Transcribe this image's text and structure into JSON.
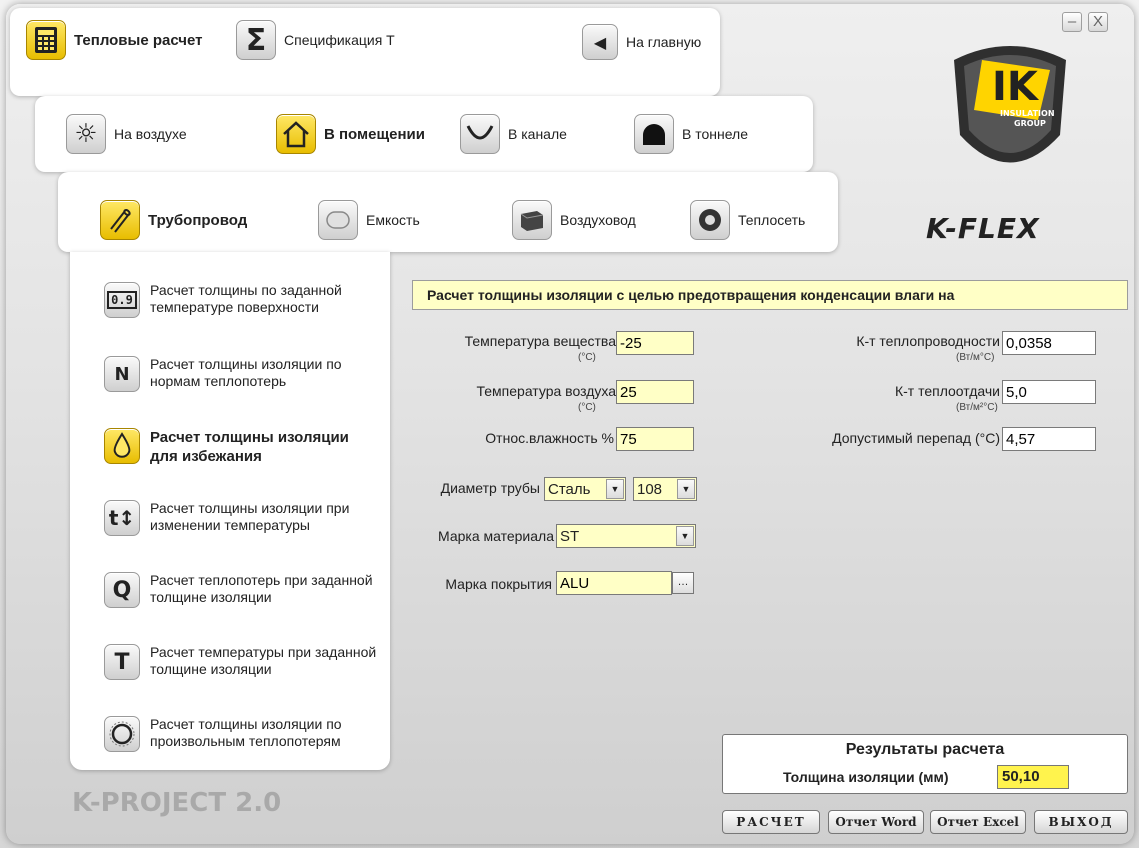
{
  "window": {
    "minimize_label": "–",
    "close_label": "X"
  },
  "top_nav": {
    "thermal": "Тепловые расчет",
    "spec": "Спецификация Т",
    "home": "На главную"
  },
  "location_tabs": {
    "outdoor": "На воздухе",
    "indoor": "В помещении",
    "channel": "В канале",
    "tunnel": "В тоннеле"
  },
  "object_tabs": {
    "pipeline": "Трубопровод",
    "vessel": "Емкость",
    "duct": "Воздуховод",
    "heating_net": "Теплосеть"
  },
  "sidebar": [
    {
      "icon": "0.9",
      "label": "Расчет толщины по заданной температуре поверхности"
    },
    {
      "icon": "N",
      "label": "Расчет толщины изоляции по нормам теплопотерь"
    },
    {
      "icon": "drop",
      "label": "Расчет толщины изоляции для избежания"
    },
    {
      "icon": "t↕",
      "label": "Расчет толщины изоляции при изменении температуры"
    },
    {
      "icon": "Q",
      "label": "Расчет теплопотерь при заданной толщине изоляции"
    },
    {
      "icon": "T",
      "label": "Расчет температуры при заданной толщине изоляции"
    },
    {
      "icon": "dial",
      "label": "Расчет толщины изоляции по произвольным теплопотерям"
    }
  ],
  "brand": {
    "logo_text": "K-FLEX",
    "shield_text": "IK",
    "shield_sub1": "INSULATION",
    "shield_sub2": "GROUP",
    "product": "K-PROJECT 2.0"
  },
  "form": {
    "title": "Расчет толщины изоляции с целью предотвращения конденсации влаги на",
    "substance_temp_label": "Температура вещества",
    "substance_temp_unit": "(°C)",
    "substance_temp_value": "-25",
    "air_temp_label": "Температура воздуха",
    "air_temp_unit": "(°C)",
    "air_temp_value": "25",
    "humidity_label": "Относ.влажность %",
    "humidity_value": "75",
    "diameter_label": "Диаметр трубы",
    "diameter_material": "Сталь",
    "diameter_value": "108",
    "material_label": "Марка материала",
    "material_value": "ST",
    "coating_label": "Марка покрытия",
    "coating_value": "ALU",
    "conductivity_label": "К-т теплопроводности",
    "conductivity_unit": "(Вт/м°С)",
    "conductivity_value": "0,0358",
    "transfer_label": "К-т теплоотдачи",
    "transfer_unit": "(Вт/м²°С)",
    "transfer_value": "5,0",
    "delta_label": "Допустимый перепад (°C)",
    "delta_value": "4,57"
  },
  "result": {
    "title": "Результаты расчета",
    "label": "Толщина изоляции (мм)",
    "value": "50,10"
  },
  "buttons": {
    "calc": "РАСЧЕТ",
    "word": "Отчет Word",
    "excel": "Отчет Excel",
    "exit": "ВЫХОД"
  }
}
